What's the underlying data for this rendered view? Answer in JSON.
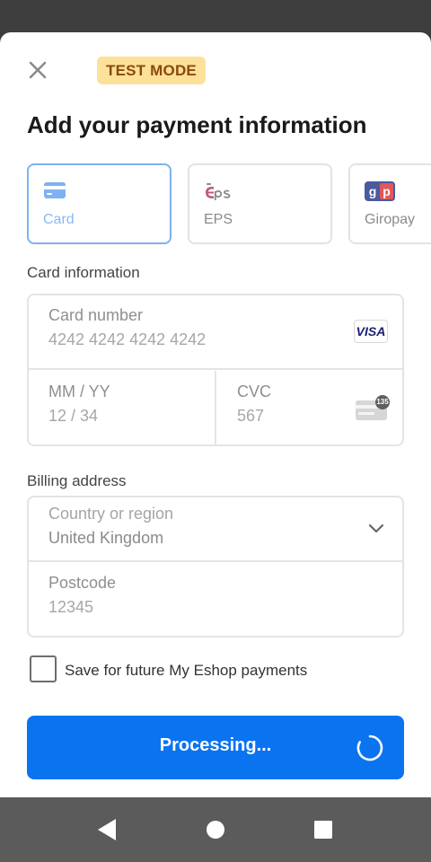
{
  "badge": "TEST MODE",
  "title": "Add your payment information",
  "tabs": [
    {
      "label": "Card",
      "icon": "card-icon"
    },
    {
      "label": "EPS",
      "icon": "eps-logo-icon"
    },
    {
      "label": "Giropay",
      "icon": "giropay-logo-icon"
    }
  ],
  "card_section": {
    "label": "Card information",
    "number_label": "Card number",
    "number_placeholder": "4242 4242 4242 4242",
    "brand": "VISA",
    "expiry_label": "MM / YY",
    "expiry_placeholder": "12 / 34",
    "cvc_label": "CVC",
    "cvc_placeholder": "567",
    "cvc_badge": "135"
  },
  "billing": {
    "label": "Billing address",
    "country_label": "Country or region",
    "country_value": "United Kingdom",
    "postcode_label": "Postcode",
    "postcode_placeholder": "12345"
  },
  "save_label": "Save for future My Eshop payments",
  "pay_button": "Processing...",
  "colors": {
    "accent": "#0a74f0",
    "badge_bg": "#fde09a",
    "badge_text": "#8a4b08",
    "selected_tab_border": "#7fb1f0"
  }
}
